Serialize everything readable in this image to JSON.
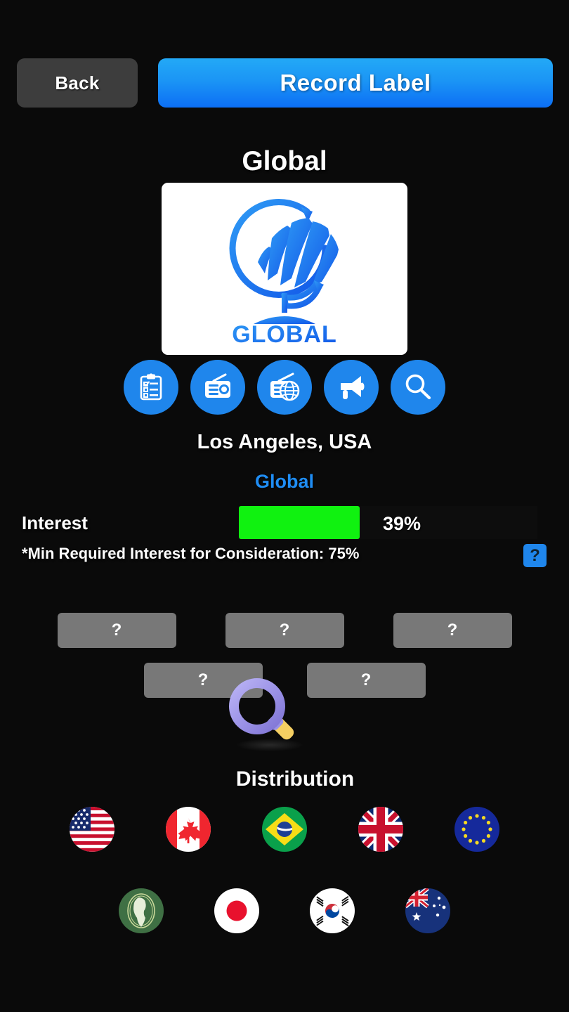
{
  "header": {
    "back_label": "Back",
    "title": "Record Label"
  },
  "label": {
    "name": "Global",
    "logo_text": "GLOBAL",
    "logo_alt": "globe-logo",
    "location": "Los Angeles, USA",
    "genre": "Global"
  },
  "actions": [
    {
      "name": "contract-icon",
      "label": "Contract"
    },
    {
      "name": "radio-icon",
      "label": "Radio"
    },
    {
      "name": "radio-global-icon",
      "label": "Global Radio"
    },
    {
      "name": "promotion-icon",
      "label": "Promotion"
    },
    {
      "name": "search-icon",
      "label": "Search"
    }
  ],
  "interest": {
    "label": "Interest",
    "percent_text": "39%",
    "percent_value": 39,
    "bar_color": "#10f210",
    "min_note": "*Min Required Interest for Consideration: 75%",
    "min_required": 75,
    "help_label": "?"
  },
  "slots": {
    "row1": [
      "?",
      "?",
      "?"
    ],
    "row2": [
      "?",
      "?"
    ]
  },
  "cursor": {
    "name": "magnifying-glass-cursor",
    "ring_color": "#9d95e8",
    "handle_color": "#f8cc55"
  },
  "distribution": {
    "title": "Distribution",
    "row1": [
      {
        "name": "flag-usa",
        "label": "United States"
      },
      {
        "name": "flag-canada",
        "label": "Canada"
      },
      {
        "name": "flag-brazil",
        "label": "Brazil"
      },
      {
        "name": "flag-uk",
        "label": "United Kingdom"
      },
      {
        "name": "flag-eu",
        "label": "European Union"
      }
    ],
    "row2": [
      {
        "name": "flag-african-union",
        "label": "African Union"
      },
      {
        "name": "flag-japan",
        "label": "Japan"
      },
      {
        "name": "flag-south-korea",
        "label": "South Korea"
      },
      {
        "name": "flag-australia",
        "label": "Australia"
      }
    ]
  },
  "colors": {
    "background": "#0a0a0a",
    "accent_blue": "#1f86ec",
    "title_gradient_top": "#23a9f6",
    "title_gradient_bottom": "#0c6ff5",
    "back_button": "#3d3d3d",
    "slot_button": "#787878",
    "genre_text": "#1f8df4"
  }
}
